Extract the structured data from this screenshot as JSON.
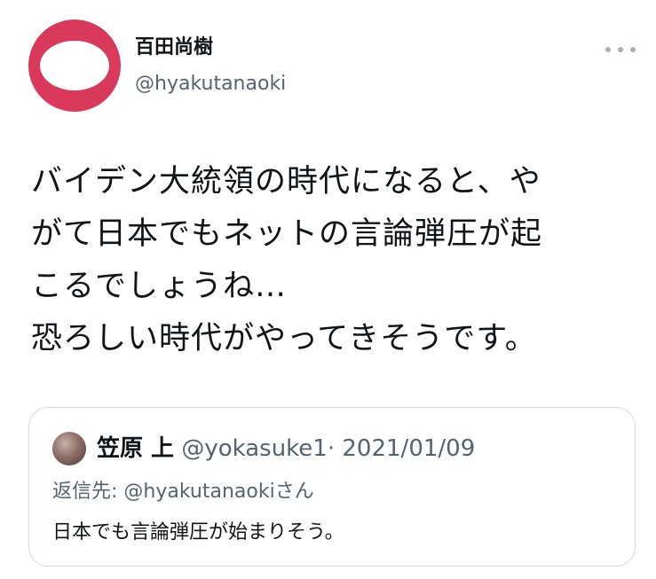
{
  "author": {
    "display_name": "百田尚樹",
    "handle": "@hyakutanaoki",
    "avatar_color": "#d9395a"
  },
  "more_icon": "more-horizontal-icon",
  "tweet": {
    "lines": [
      "バイデン大統領の時代になると、や",
      "がて日本でもネットの言論弾圧が起",
      "こるでしょうね…",
      "恐ろしい時代がやってきそうです。"
    ]
  },
  "quote": {
    "display_name": "笠原 上",
    "handle": "@yokasuke1",
    "separator": "·",
    "date": "2021/01/09",
    "reply_label": "返信先: ",
    "reply_handle": "@hyakutanaoki",
    "reply_suffix": "さん",
    "text": "日本でも言論弾圧が始まりそう。"
  },
  "colors": {
    "text_primary": "#0f1419",
    "text_secondary": "#536471",
    "border": "#cfd9de"
  }
}
